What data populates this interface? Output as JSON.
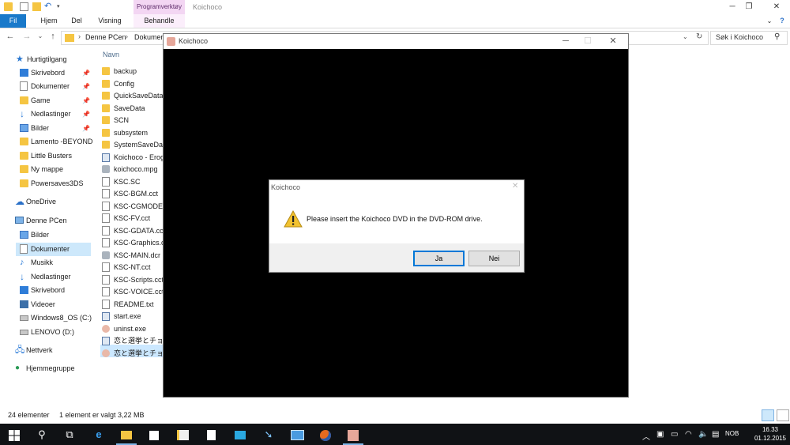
{
  "explorer": {
    "title": "Koichoco",
    "tool_tab_header": "Programverktøy",
    "ribbon_tabs": [
      "Fil",
      "Hjem",
      "Del",
      "Visning",
      "Behandle"
    ],
    "address": {
      "crumb1": "Denne PCen",
      "crumb2": "Dokumenter"
    },
    "search_placeholder": "Søk i Koichoco",
    "column_header": "Navn",
    "nav_items": [
      {
        "label": "Hurtigtilgang",
        "icon": "star-icon"
      },
      {
        "label": "Skrivebord",
        "icon": "desktop-icon",
        "pinned": true
      },
      {
        "label": "Dokumenter",
        "icon": "documents-icon",
        "pinned": true
      },
      {
        "label": "Game",
        "icon": "folder-icon",
        "pinned": true
      },
      {
        "label": "Nedlastinger",
        "icon": "download-icon",
        "pinned": true
      },
      {
        "label": "Bilder",
        "icon": "pictures-icon",
        "pinned": true
      },
      {
        "label": "Lamento -BEYOND",
        "icon": "folder-icon"
      },
      {
        "label": "Little Busters",
        "icon": "folder-icon"
      },
      {
        "label": "Ny mappe",
        "icon": "folder-icon"
      },
      {
        "label": "Powersaves3DS",
        "icon": "folder-icon"
      },
      {
        "label": "OneDrive",
        "icon": "cloud-icon"
      },
      {
        "label": "Denne PCen",
        "icon": "computer-icon"
      },
      {
        "label": "Bilder",
        "icon": "pictures-icon"
      },
      {
        "label": "Dokumenter",
        "icon": "documents-icon",
        "selected": true
      },
      {
        "label": "Musikk",
        "icon": "music-icon"
      },
      {
        "label": "Nedlastinger",
        "icon": "download-icon"
      },
      {
        "label": "Skrivebord",
        "icon": "desktop-icon"
      },
      {
        "label": "Videoer",
        "icon": "videos-icon"
      },
      {
        "label": "Windows8_OS (C:)",
        "icon": "drive-icon"
      },
      {
        "label": "LENOVO (D:)",
        "icon": "drive-icon"
      },
      {
        "label": "Nettverk",
        "icon": "network-icon"
      },
      {
        "label": "Hjemmegruppe",
        "icon": "homegroup-icon"
      }
    ],
    "files": [
      {
        "name": "backup",
        "icon": "folder-icon"
      },
      {
        "name": "Config",
        "icon": "folder-icon"
      },
      {
        "name": "QuickSaveData",
        "icon": "folder-icon"
      },
      {
        "name": "SaveData",
        "icon": "folder-icon"
      },
      {
        "name": "SCN",
        "icon": "folder-icon"
      },
      {
        "name": "subsystem",
        "icon": "folder-icon"
      },
      {
        "name": "SystemSaveData",
        "icon": "folder-icon"
      },
      {
        "name": "Koichoco - Erog",
        "icon": "shortcut-icon"
      },
      {
        "name": "koichoco.mpg",
        "icon": "video-file-icon"
      },
      {
        "name": "KSC.SC",
        "icon": "file-icon"
      },
      {
        "name": "KSC-BGM.cct",
        "icon": "file-icon"
      },
      {
        "name": "KSC-CGMODE.c",
        "icon": "file-icon"
      },
      {
        "name": "KSC-FV.cct",
        "icon": "file-icon"
      },
      {
        "name": "KSC-GDATA.cct",
        "icon": "file-icon"
      },
      {
        "name": "KSC-Graphics.cc",
        "icon": "file-icon"
      },
      {
        "name": "KSC-MAIN.dcr",
        "icon": "gear-file-icon"
      },
      {
        "name": "KSC-NT.cct",
        "icon": "file-icon"
      },
      {
        "name": "KSC-Scripts.cct",
        "icon": "file-icon"
      },
      {
        "name": "KSC-VOICE.cct",
        "icon": "file-icon"
      },
      {
        "name": "README.txt",
        "icon": "text-file-icon"
      },
      {
        "name": "start.exe",
        "icon": "exe-icon"
      },
      {
        "name": "uninst.exe",
        "icon": "app-icon"
      },
      {
        "name": "恋と選挙とチョコ",
        "icon": "exe-icon"
      },
      {
        "name": "恋と選挙とチョコ",
        "icon": "app-icon",
        "selected": true
      }
    ],
    "status": {
      "count": "24 elementer",
      "selection": "1 element er valgt  3,22 MB"
    }
  },
  "game_window": {
    "title": "Koichoco"
  },
  "dialog": {
    "title": "Koichoco",
    "message": "Please insert the Koichoco DVD in the DVD-ROM drive.",
    "yes_label": "Ja",
    "no_label": "Nei"
  },
  "taskbar": {
    "language": "NOB",
    "time": "16.33",
    "date": "01.12.2015"
  },
  "colors": {
    "ribbon_file_tab": "#1979ca",
    "tool_tab": "#f3d6f3",
    "taskbar": "#101215",
    "selection": "#cde8fb"
  }
}
